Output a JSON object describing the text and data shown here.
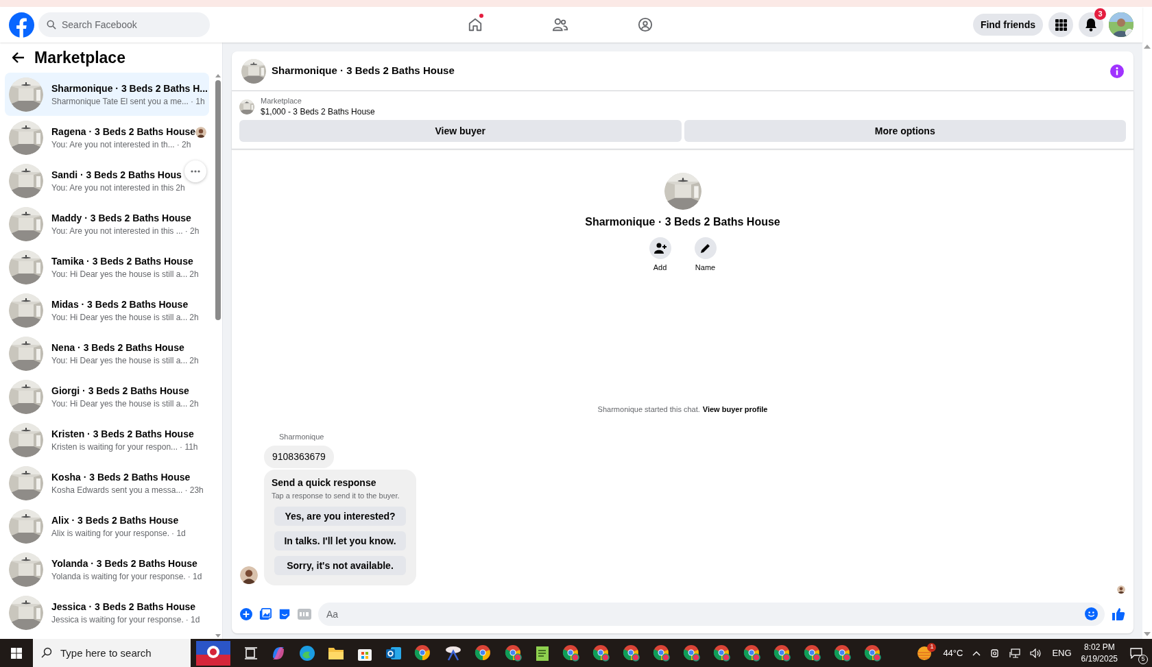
{
  "header": {
    "search_placeholder": "Search Facebook",
    "home_has_dot": true,
    "find_friends": "Find friends",
    "notifications_badge": "3"
  },
  "sidebar": {
    "title": "Marketplace",
    "conversations": [
      {
        "name": "Sharmonique · 3 Beds 2 Baths H...",
        "preview": "Sharmonique Tate El sent you a me...",
        "time": "· 1h",
        "selected": true,
        "seen_avatar": false,
        "more_button": false
      },
      {
        "name": "Ragena · 3 Beds 2 Baths House",
        "preview": "You: Are you not interested in th...",
        "time": "· 2h",
        "selected": false,
        "seen_avatar": true,
        "more_button": false
      },
      {
        "name": "Sandi · 3 Beds 2 Baths Hous",
        "preview": "You: Are you not interested in this",
        "time": "2h",
        "selected": false,
        "seen_avatar": false,
        "more_button": true
      },
      {
        "name": "Maddy · 3 Beds 2 Baths House",
        "preview": "You: Are you not interested in this ...",
        "time": "· 2h",
        "selected": false,
        "seen_avatar": false,
        "more_button": false
      },
      {
        "name": "Tamika · 3 Beds 2 Baths House",
        "preview": "You: Hi Dear yes the house is still a...",
        "time": "2h",
        "selected": false,
        "seen_avatar": false,
        "more_button": false
      },
      {
        "name": "Midas · 3 Beds 2 Baths House",
        "preview": "You: Hi Dear yes the house is still a...",
        "time": "2h",
        "selected": false,
        "seen_avatar": false,
        "more_button": false
      },
      {
        "name": "Nena · 3 Beds 2 Baths House",
        "preview": "You: Hi Dear yes the house is still a...",
        "time": "2h",
        "selected": false,
        "seen_avatar": false,
        "more_button": false
      },
      {
        "name": "Giorgi · 3 Beds 2 Baths House",
        "preview": "You: Hi Dear yes the house is still a...",
        "time": "2h",
        "selected": false,
        "seen_avatar": false,
        "more_button": false
      },
      {
        "name": "Kristen · 3 Beds 2 Baths House",
        "preview": "Kristen is waiting for your respon...",
        "time": "· 11h",
        "selected": false,
        "seen_avatar": false,
        "more_button": false
      },
      {
        "name": "Kosha · 3 Beds 2 Baths House",
        "preview": "Kosha Edwards sent you a messa...",
        "time": "· 23h",
        "selected": false,
        "seen_avatar": false,
        "more_button": false
      },
      {
        "name": "Alix · 3 Beds 2 Baths House",
        "preview": "Alix is waiting for your response.",
        "time": "· 1d",
        "selected": false,
        "seen_avatar": false,
        "more_button": false
      },
      {
        "name": "Yolanda · 3 Beds 2 Baths House",
        "preview": "Yolanda is waiting for your response.",
        "time": "· 1d",
        "selected": false,
        "seen_avatar": false,
        "more_button": false
      },
      {
        "name": "Jessica · 3 Beds 2 Baths House",
        "preview": "Jessica is waiting for your response.",
        "time": "· 1d",
        "selected": false,
        "seen_avatar": false,
        "more_button": false
      }
    ]
  },
  "chat": {
    "title": "Sharmonique · 3 Beds 2 Baths House",
    "listing": {
      "label": "Marketplace",
      "item": "$1,000 - 3 Beds 2 Baths House",
      "buttons": [
        "View buyer",
        "More options"
      ]
    },
    "profile": {
      "name": "Sharmonique · 3 Beds 2 Baths House",
      "actions": [
        {
          "kind": "add",
          "label": "Add"
        },
        {
          "kind": "name",
          "label": "Name"
        }
      ]
    },
    "system_message": {
      "text": "Sharmonique started this chat.",
      "link": "View buyer profile"
    },
    "sender": "Sharmonique",
    "message": "9108363679",
    "quick_response": {
      "title": "Send a quick response",
      "subtitle": "Tap a response to send it to the buyer.",
      "options": [
        "Yes, are you interested?",
        "In talks. I'll let you know.",
        "Sorry, it's not available."
      ]
    },
    "composer_placeholder": "Aa"
  },
  "taskbar": {
    "search_placeholder": "Type here to search",
    "weather_badge": "1",
    "temperature": "44°C",
    "language": "ENG",
    "time": "8:02 PM",
    "date": "6/19/2025",
    "notifications_count": "5"
  }
}
